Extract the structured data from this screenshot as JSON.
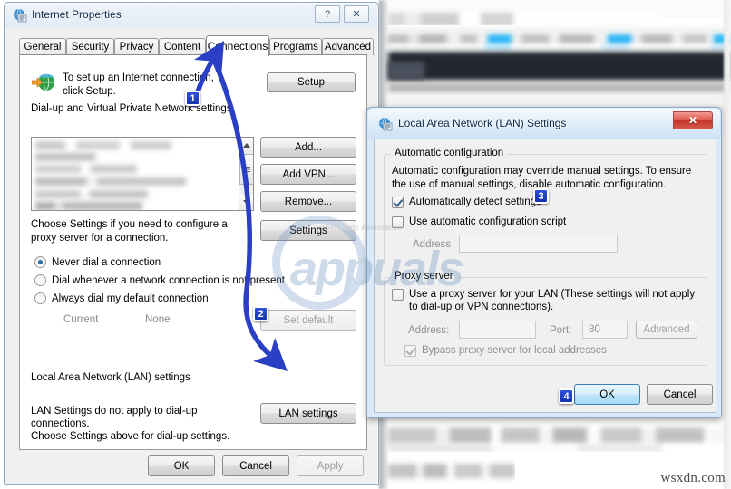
{
  "background": {
    "watermark_site": "wsxdn.com",
    "overlay_watermark": "appuals",
    "overlay_tagline": "Expert Tech Assistance"
  },
  "internet_properties": {
    "title": "Internet Properties",
    "icon": "internet-properties-icon",
    "titlebar_buttons": [
      {
        "name": "help-button",
        "glyph": "?"
      },
      {
        "name": "close-button",
        "glyph": "✕"
      }
    ],
    "tabs": [
      {
        "label": "General",
        "active": false
      },
      {
        "label": "Security",
        "active": false
      },
      {
        "label": "Privacy",
        "active": false
      },
      {
        "label": "Content",
        "active": false
      },
      {
        "label": "Connections",
        "active": true
      },
      {
        "label": "Programs",
        "active": false
      },
      {
        "label": "Advanced",
        "active": false
      }
    ],
    "setup": {
      "text": "To set up an Internet connection, click Setup.",
      "button": "Setup"
    },
    "dialup_group": {
      "label": "Dial-up and Virtual Private Network settings",
      "buttons": [
        {
          "label": "Add...",
          "disabled": false
        },
        {
          "label": "Add VPN...",
          "disabled": false
        },
        {
          "label": "Remove...",
          "disabled": false
        },
        {
          "label": "Settings",
          "disabled": false
        }
      ]
    },
    "choose_settings_text": "Choose Settings if you need to configure a proxy server for a connection.",
    "dial_options": [
      {
        "label": "Never dial a connection",
        "checked": true
      },
      {
        "label": "Dial whenever a network connection is not present",
        "checked": false
      },
      {
        "label": "Always dial my default connection",
        "checked": false
      }
    ],
    "current_label": "Current",
    "current_value": "None",
    "set_default_button": "Set default",
    "lan_group": {
      "label": "Local Area Network (LAN) settings",
      "description_line1": "LAN Settings do not apply to dial-up connections.",
      "description_line2": "Choose Settings above for dial-up settings.",
      "button": "LAN settings"
    },
    "footer_buttons": [
      {
        "label": "OK",
        "disabled": false
      },
      {
        "label": "Cancel",
        "disabled": false
      },
      {
        "label": "Apply",
        "disabled": true
      }
    ]
  },
  "lan_settings": {
    "title": "Local Area Network (LAN) Settings",
    "icon": "lan-settings-icon",
    "close_glyph": "✕",
    "automatic_configuration": {
      "group_label": "Automatic configuration",
      "description": "Automatic configuration may override manual settings.  To ensure the use of manual settings, disable automatic configuration.",
      "auto_detect": {
        "label": "Automatically detect settings",
        "checked": true
      },
      "use_script": {
        "label": "Use automatic configuration script",
        "checked": false
      },
      "address_label": "Address",
      "address_value": ""
    },
    "proxy_server": {
      "group_label": "Proxy server",
      "use_proxy": {
        "label": "Use a proxy server for your LAN (These settings will not apply to dial-up or VPN connections).",
        "checked": false
      },
      "address_label": "Address:",
      "address_value": "",
      "port_label": "Port:",
      "port_value": "80",
      "advanced_button": "Advanced",
      "bypass": {
        "label": "Bypass proxy server for local addresses",
        "checked": true
      }
    },
    "footer_buttons": [
      {
        "label": "OK",
        "default": true
      },
      {
        "label": "Cancel",
        "default": false
      }
    ]
  },
  "annotations": {
    "accent_color": "#2a3fc4",
    "steps": [
      {
        "number": "1",
        "target": "connections-tab"
      },
      {
        "number": "2",
        "target": "lan-settings-button"
      },
      {
        "number": "3",
        "target": "automatically-detect-settings-checkbox"
      },
      {
        "number": "4",
        "target": "lan-ok-button"
      }
    ]
  }
}
